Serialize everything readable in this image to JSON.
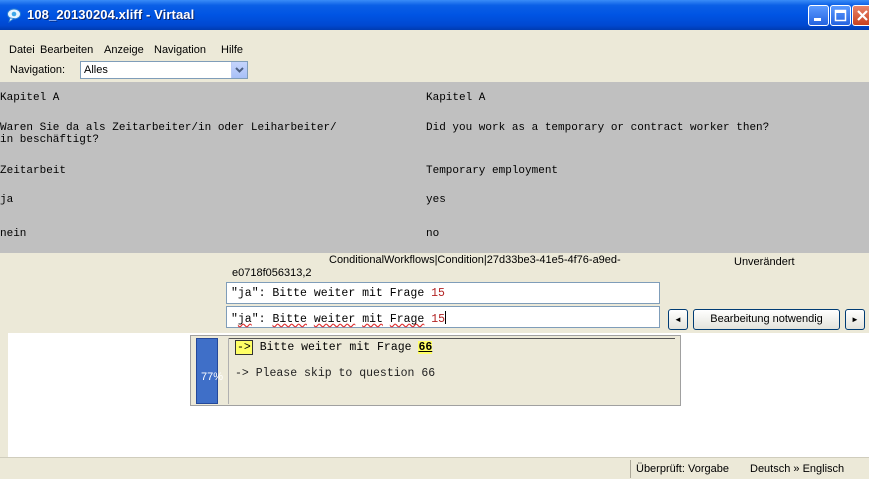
{
  "window": {
    "title": "108_20130204.xliff - Virtaal",
    "icon": "virtaal-app-icon"
  },
  "menu": {
    "items": [
      "Datei",
      "Bearbeiten",
      "Anzeige",
      "Navigation",
      "Hilfe"
    ]
  },
  "navigation": {
    "label": "Navigation:",
    "selected": "Alles"
  },
  "segments": [
    {
      "source": "Kapitel A",
      "target": "Kapitel A"
    },
    {
      "source": "Waren Sie da als Zeitarbeiter/in oder Leiharbeiter/\nin beschäftigt?",
      "target": "Did you work as a temporary or contract worker then?"
    },
    {
      "source": "Zeitarbeit",
      "target": "Temporary employment"
    },
    {
      "source": "ja",
      "target": "yes"
    },
    {
      "source": "nein",
      "target": "no"
    }
  ],
  "editor": {
    "segment_id_line1": "ConditionalWorkflows|Condition|27d33be3-41e5-4f76-a9ed-",
    "segment_id_line2": "e0718f056313,2",
    "state": "Unverändert",
    "source_prefix": "\"ja\": Bitte weiter mit Frage ",
    "source_number": "15",
    "target_quote_open": "\"",
    "target_ja": "ja",
    "target_quote_close": "\": ",
    "target_w_bitte": "Bitte",
    "target_w_weiter": "weiter",
    "target_w_mit": "mit",
    "target_w_frage": "Frage",
    "target_number": "15",
    "prev_button": "◄",
    "next_button": "►",
    "status_button": "Bearbeitung notwendig"
  },
  "suggestion": {
    "match_percent": "77%",
    "target_arrow": "->",
    "target_text": " Bitte weiter mit Frage ",
    "target_number": "66",
    "source_text": "-> Please skip to question 66"
  },
  "statusbar": {
    "checked": "Überprüft: Vorgabe",
    "languages": "Deutsch » Englisch"
  },
  "colors": {
    "titlebar": "#0054e3",
    "segment_bg": "#c0c0c0",
    "match_bar": "#3f6fc8",
    "number_highlight": "#b22222"
  }
}
